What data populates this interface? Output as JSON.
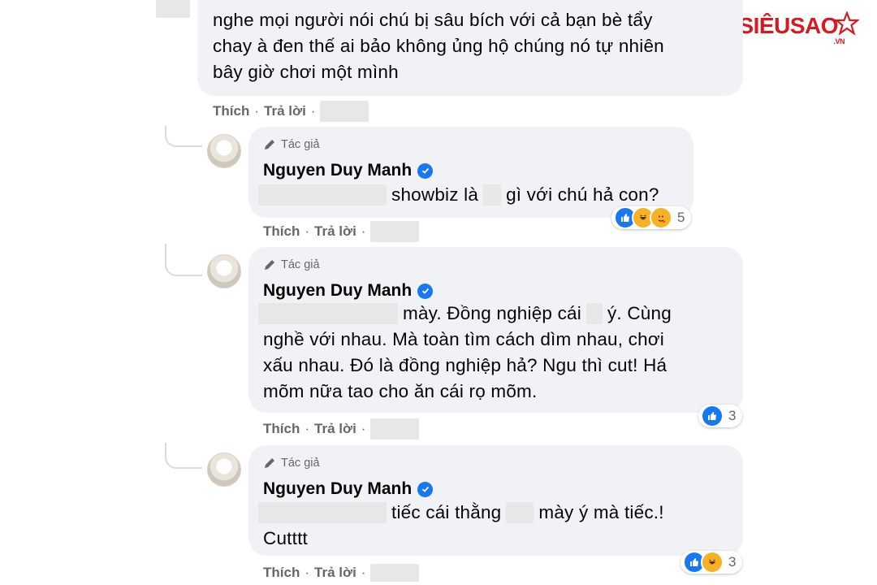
{
  "watermark": {
    "text": "SIÊUSAO",
    "sub": ".VN"
  },
  "top_comment": {
    "lines": [
      "nghe mọi người nói chú bị sâu bích với cả bạn bè tẩy",
      "chay à đen thế ai bảo không ủng hộ chúng nó tự nhiên",
      "bây giờ chơi một mình"
    ],
    "like_label": "Thích",
    "reply_label": "Trả lời"
  },
  "replies": [
    {
      "author_tag": "Tác giả",
      "name": "Nguyen Duy Manh",
      "text_parts": [
        "showbiz là",
        "gì với chú hả con?"
      ],
      "like_label": "Thích",
      "reply_label": "Trả lời",
      "reaction_count": "5",
      "reactions": [
        "like",
        "haha",
        "care"
      ]
    },
    {
      "author_tag": "Tác giả",
      "name": "Nguyen Duy Manh",
      "text_parts": [
        "mày. Đồng nghiệp cái",
        "ý. Cùng"
      ],
      "text_lines": [
        "nghề với nhau. Mà toàn tìm cách dìm nhau, chơi",
        "xấu nhau. Đó là đồng nghiệp hả? Ngu thì cut! Há",
        "mõm nữa tao cho ăn cái rọ mõm."
      ],
      "like_label": "Thích",
      "reply_label": "Trả lời",
      "reaction_count": "3",
      "reactions": [
        "like"
      ]
    },
    {
      "author_tag": "Tác giả",
      "name": "Nguyen Duy Manh",
      "text_parts": [
        "tiếc cái thằng",
        "mày ý mà tiếc.!"
      ],
      "text_lines": [
        "Cutttt"
      ],
      "like_label": "Thích",
      "reply_label": "Trả lời",
      "reaction_count": "3",
      "reactions": [
        "like",
        "haha"
      ]
    }
  ],
  "colors": {
    "bubble": "#f0f2f5",
    "muted": "#65676b",
    "verified": "#1877f2",
    "brand": "#d71920"
  }
}
